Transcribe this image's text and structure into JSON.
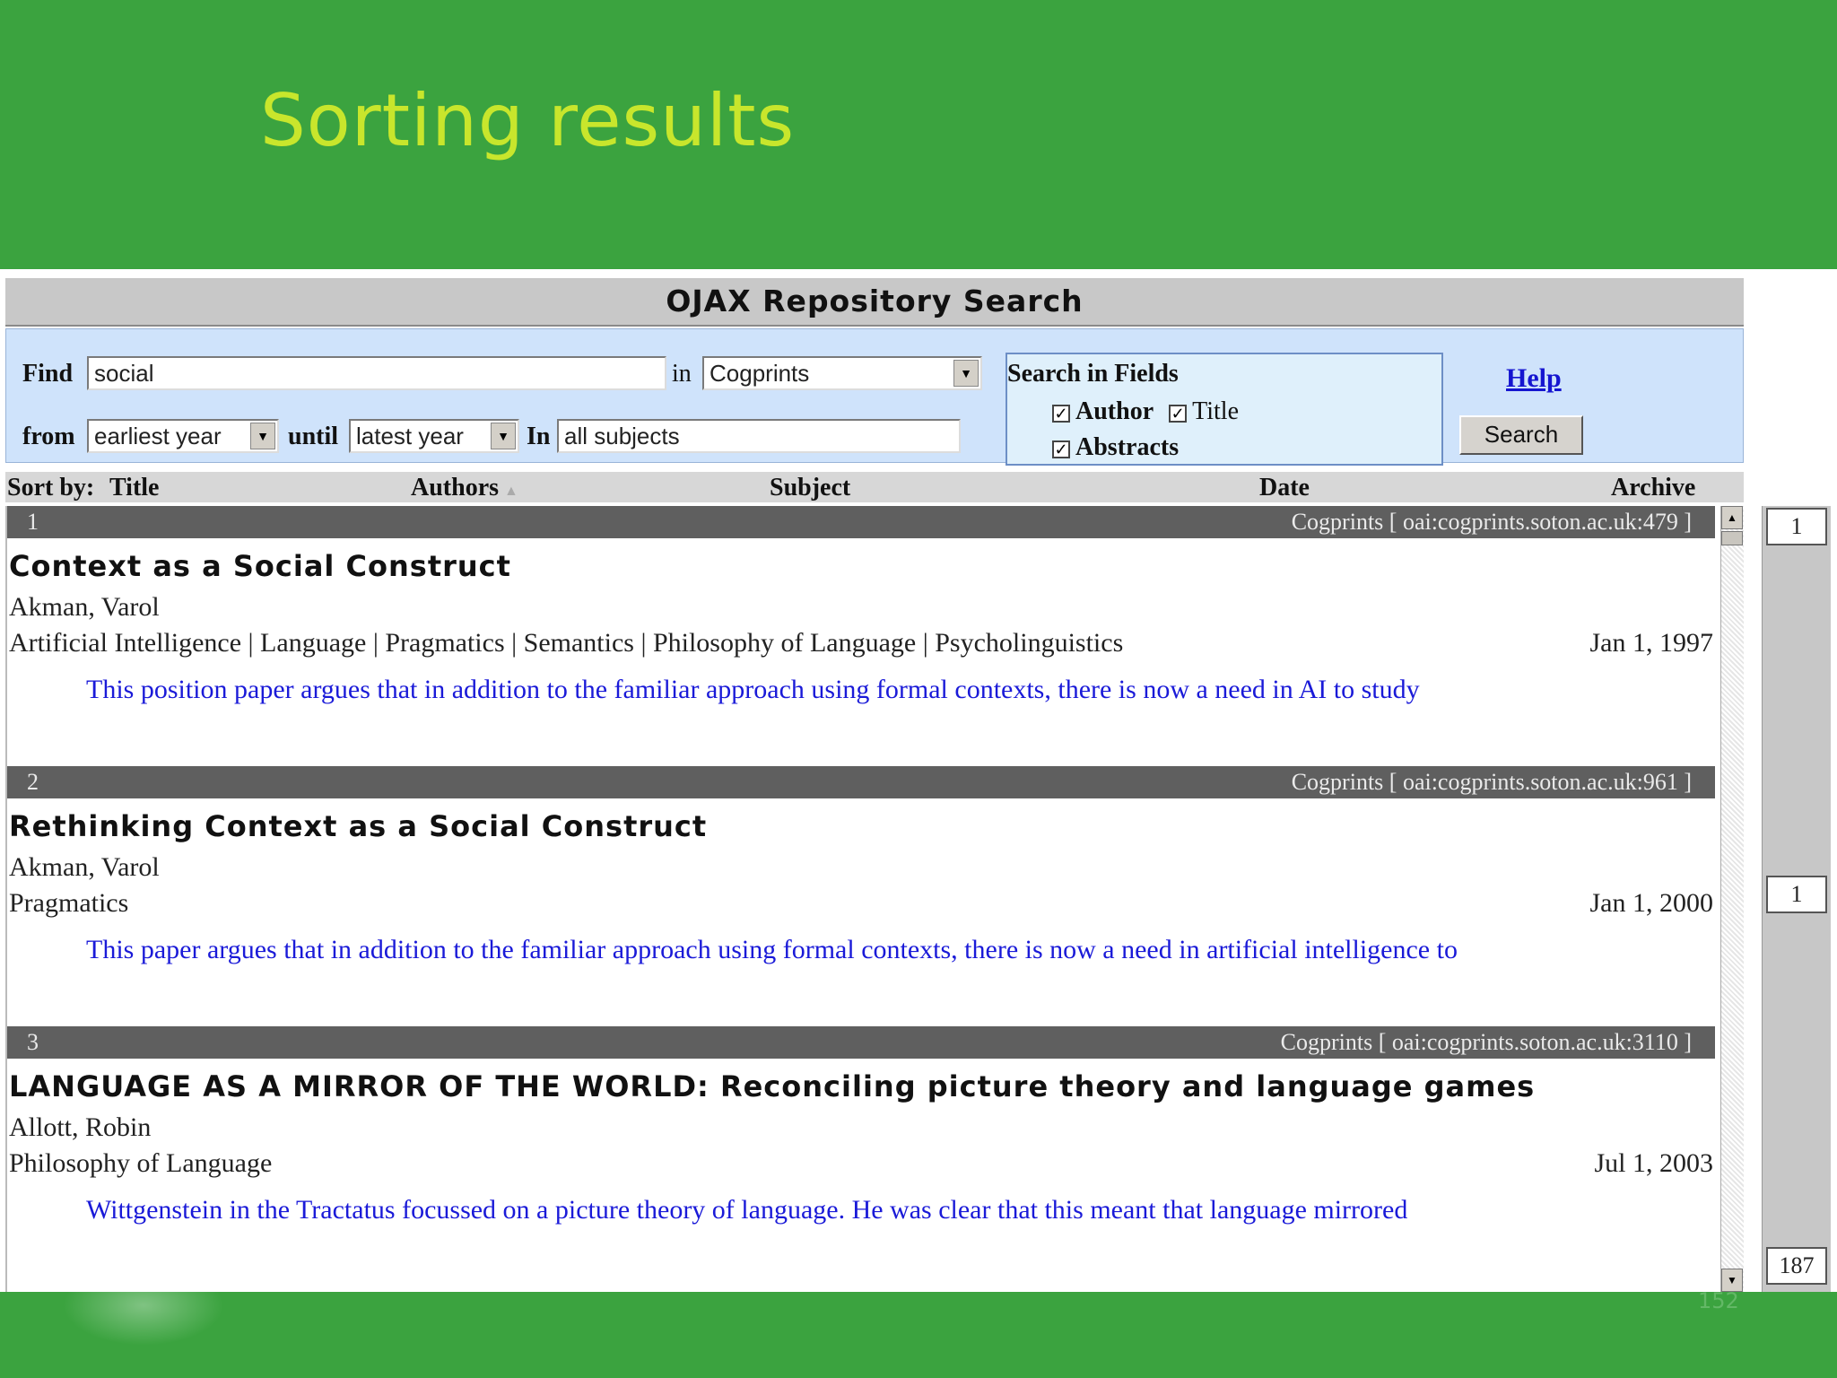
{
  "slide": {
    "title": "Sorting results",
    "page_number": "152"
  },
  "app": {
    "title": "OJAX Repository Search",
    "find_label": "Find",
    "find_value": "social",
    "in_label": "in",
    "repository_value": "Cogprints",
    "from_label": "from",
    "from_value": "earliest year",
    "until_label": "until",
    "until_value": "latest year",
    "in_subject_label": "In",
    "subject_value": "all subjects",
    "fields_heading": "Search in Fields",
    "field_author": "Author",
    "field_title": "Title",
    "field_abstracts": "Abstracts",
    "help_label": "Help",
    "search_label": "Search"
  },
  "sort": {
    "label": "Sort by:",
    "title": "Title",
    "authors": "Authors",
    "subject": "Subject",
    "date": "Date",
    "archive": "Archive"
  },
  "results": [
    {
      "num": "1",
      "archive": "Cogprints [ oai:cogprints.soton.ac.uk:479 ]",
      "title": "Context as a Social Construct",
      "author": "Akman, Varol",
      "subject": "Artificial Intelligence | Language | Pragmatics | Semantics | Philosophy of Language | Psycholinguistics",
      "date": "Jan 1, 1997",
      "abstract": "This position paper argues that in addition to the familiar approach using formal contexts, there is now a need in AI to study"
    },
    {
      "num": "2",
      "archive": "Cogprints [ oai:cogprints.soton.ac.uk:961 ]",
      "title": "Rethinking Context as a Social Construct",
      "author": "Akman, Varol",
      "subject": "Pragmatics",
      "date": "Jan 1, 2000",
      "abstract": "This paper argues that in addition to the familiar approach using formal contexts, there is now a need in artificial intelligence to"
    },
    {
      "num": "3",
      "archive": "Cogprints [ oai:cogprints.soton.ac.uk:3110 ]",
      "title": "LANGUAGE AS A MIRROR OF THE WORLD: Reconciling picture theory and language games",
      "author": "Allott, Robin",
      "subject": "Philosophy of Language",
      "date": "Jul 1, 2003",
      "abstract": "Wittgenstein in the Tractatus focussed on a picture theory of language. He was clear that this meant that language mirrored"
    }
  ],
  "pager": {
    "top": "1",
    "middle": "1",
    "bottom": "187"
  }
}
